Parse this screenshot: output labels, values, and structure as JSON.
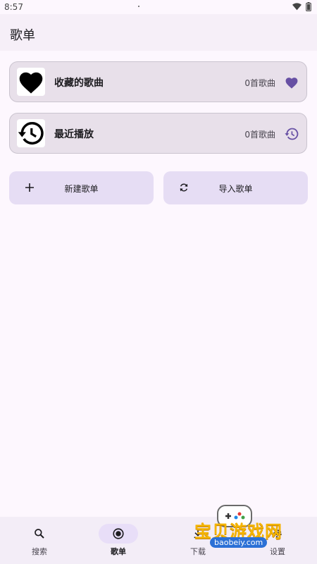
{
  "status_bar": {
    "time": "8:57"
  },
  "app_bar": {
    "title": "歌单"
  },
  "cards": [
    {
      "title": "收藏的歌曲",
      "count": "0首歌曲",
      "thumb_icon": "heart-icon",
      "trailing_icon": "heart-icon"
    },
    {
      "title": "最近播放",
      "count": "0首歌曲",
      "thumb_icon": "history-icon",
      "trailing_icon": "history-icon"
    }
  ],
  "actions": [
    {
      "label": "新建歌单",
      "icon": "plus-icon"
    },
    {
      "label": "导入歌单",
      "icon": "sync-icon"
    }
  ],
  "bottom_nav": [
    {
      "label": "搜索",
      "icon": "search-icon",
      "active": false
    },
    {
      "label": "歌单",
      "icon": "radio-button-icon",
      "active": true
    },
    {
      "label": "下载",
      "icon": "download-icon",
      "active": false
    },
    {
      "label": "设置",
      "icon": "gear-icon",
      "active": false
    }
  ],
  "watermark": {
    "text": "宝贝游戏网",
    "url": "baobeiy.com"
  },
  "colors": {
    "accent": "#6750a4",
    "background": "#fdf7fe",
    "card": "#e8e0ea",
    "button": "#e6ddf4",
    "nav_active": "#e8def8"
  }
}
